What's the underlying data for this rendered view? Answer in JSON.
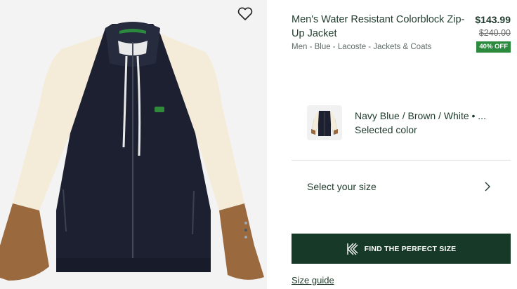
{
  "product": {
    "title": "Men's Water Resistant Colorblock Zip-Up Jacket",
    "price": "$143.99",
    "old_price": "$240.00",
    "discount": "40% OFF",
    "breadcrumb": "Men - Blue - Lacoste - Jackets & Coats"
  },
  "color": {
    "name": "Navy Blue / Brown / White • ...",
    "status": "Selected color"
  },
  "size": {
    "label": "Select your size"
  },
  "fit_button": {
    "label": "FIND THE PERFECT SIZE",
    "icon": "kiwi-sizing-logo"
  },
  "size_guide": {
    "label": "Size guide"
  },
  "icons": {
    "favorite": "heart-icon",
    "chevron": "chevron-right-icon"
  },
  "colors": {
    "navy": "#1c2030",
    "cream": "#f4ecd9",
    "brown": "#9a6a3e",
    "button": "#163a27",
    "discount_bg": "#2b8a3e"
  },
  "gallery": {
    "image_count": 3,
    "active_index": 1
  }
}
